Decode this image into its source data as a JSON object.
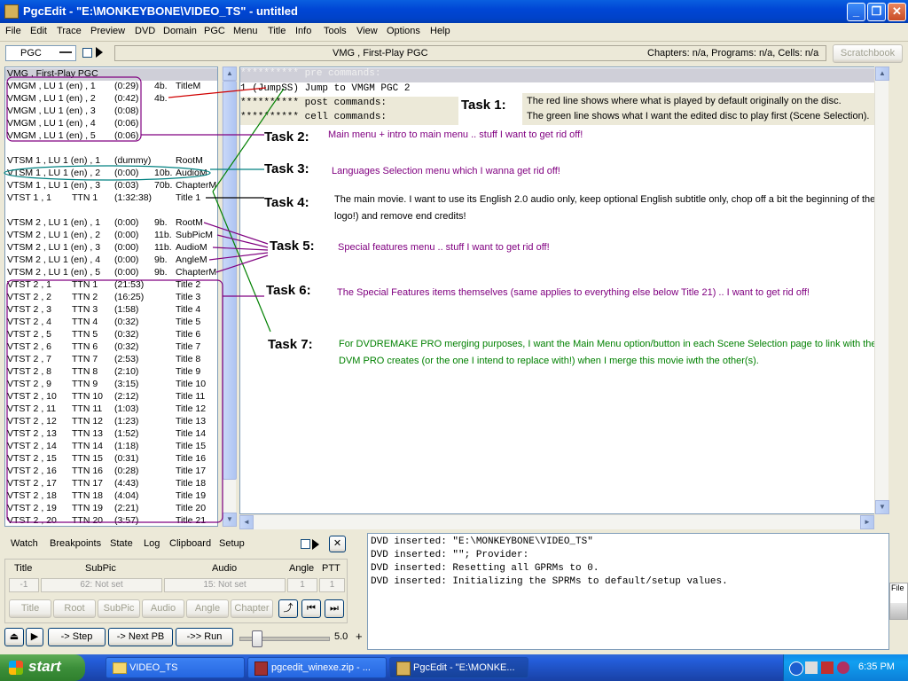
{
  "window": {
    "title": "PgcEdit - \"E:\\MONKEYBONE\\VIDEO_TS\" - untitled",
    "min_glyph": "_",
    "max_glyph": "❐",
    "close_glyph": "✕"
  },
  "menu": [
    "File",
    "Edit",
    "Trace",
    "Preview",
    "DVD",
    "Domain",
    "PGC",
    "Menu",
    "Title",
    "Info",
    "Tools",
    "View",
    "Options",
    "Help"
  ],
  "toolbar": {
    "domain_select": "PGC",
    "current_pgc": "VMG , First-Play PGC",
    "stats": "Chapters: n/a,  Programs: n/a,  Cells: n/a",
    "scratchbook": "Scratchbook"
  },
  "pgc_list": [
    {
      "name": "VMG , First-Play PGC",
      "ttn": "",
      "time": "",
      "size": "",
      "label": ""
    },
    {
      "name": "VMGM , LU 1 (en) , 1",
      "ttn": "",
      "time": "(0:29)",
      "size": "4b.",
      "label": "TitleM"
    },
    {
      "name": "VMGM , LU 1 (en) , 2",
      "ttn": "",
      "time": "(0:42)",
      "size": "4b.",
      "label": ""
    },
    {
      "name": "VMGM , LU 1 (en) , 3",
      "ttn": "",
      "time": "(0:08)",
      "size": "",
      "label": ""
    },
    {
      "name": "VMGM , LU 1 (en) , 4",
      "ttn": "",
      "time": "(0:06)",
      "size": "",
      "label": ""
    },
    {
      "name": "VMGM , LU 1 (en) , 5",
      "ttn": "",
      "time": "(0:06)",
      "size": "",
      "label": ""
    },
    {
      "name": "",
      "ttn": "",
      "time": "",
      "size": "",
      "label": ""
    },
    {
      "name": "VTSM 1 , LU 1 (en) , 1",
      "ttn": "",
      "time": "(dummy)",
      "size": "",
      "label": "RootM"
    },
    {
      "name": "VTSM 1 , LU 1 (en) , 2",
      "ttn": "",
      "time": "(0:00)",
      "size": "10b.",
      "label": "AudioM"
    },
    {
      "name": "VTSM 1 , LU 1 (en) , 3",
      "ttn": "",
      "time": "(0:03)",
      "size": "70b.",
      "label": "ChapterM"
    },
    {
      "name": "VTST 1 , 1",
      "ttn": "TTN 1",
      "time": "(1:32:38)",
      "size": "",
      "label": "Title 1"
    },
    {
      "name": "",
      "ttn": "",
      "time": "",
      "size": "",
      "label": ""
    },
    {
      "name": "VTSM 2 , LU 1 (en) , 1",
      "ttn": "",
      "time": "(0:00)",
      "size": "9b.",
      "label": "RootM"
    },
    {
      "name": "VTSM 2 , LU 1 (en) , 2",
      "ttn": "",
      "time": "(0:00)",
      "size": "11b.",
      "label": "SubPicM"
    },
    {
      "name": "VTSM 2 , LU 1 (en) , 3",
      "ttn": "",
      "time": "(0:00)",
      "size": "11b.",
      "label": "AudioM"
    },
    {
      "name": "VTSM 2 , LU 1 (en) , 4",
      "ttn": "",
      "time": "(0:00)",
      "size": "9b.",
      "label": "AngleM"
    },
    {
      "name": "VTSM 2 , LU 1 (en) , 5",
      "ttn": "",
      "time": "(0:00)",
      "size": "9b.",
      "label": "ChapterM"
    },
    {
      "name": "VTST 2 , 1",
      "ttn": "TTN 1",
      "time": "(21:53)",
      "size": "",
      "label": "Title 2"
    },
    {
      "name": "VTST 2 , 2",
      "ttn": "TTN 2",
      "time": "(16:25)",
      "size": "",
      "label": "Title 3"
    },
    {
      "name": "VTST 2 , 3",
      "ttn": "TTN 3",
      "time": "(1:58)",
      "size": "",
      "label": "Title 4"
    },
    {
      "name": "VTST 2 , 4",
      "ttn": "TTN 4",
      "time": "(0:32)",
      "size": "",
      "label": "Title 5"
    },
    {
      "name": "VTST 2 , 5",
      "ttn": "TTN 5",
      "time": "(0:32)",
      "size": "",
      "label": "Title 6"
    },
    {
      "name": "VTST 2 , 6",
      "ttn": "TTN 6",
      "time": "(0:32)",
      "size": "",
      "label": "Title 7"
    },
    {
      "name": "VTST 2 , 7",
      "ttn": "TTN 7",
      "time": "(2:53)",
      "size": "",
      "label": "Title 8"
    },
    {
      "name": "VTST 2 , 8",
      "ttn": "TTN 8",
      "time": "(2:10)",
      "size": "",
      "label": "Title 9"
    },
    {
      "name": "VTST 2 , 9",
      "ttn": "TTN 9",
      "time": "(3:15)",
      "size": "",
      "label": "Title 10"
    },
    {
      "name": "VTST 2 , 10",
      "ttn": "TTN 10",
      "time": "(2:12)",
      "size": "",
      "label": "Title 11"
    },
    {
      "name": "VTST 2 , 11",
      "ttn": "TTN 11",
      "time": "(1:03)",
      "size": "",
      "label": "Title 12"
    },
    {
      "name": "VTST 2 , 12",
      "ttn": "TTN 12",
      "time": "(1:23)",
      "size": "",
      "label": "Title 13"
    },
    {
      "name": "VTST 2 , 13",
      "ttn": "TTN 13",
      "time": "(1:52)",
      "size": "",
      "label": "Title 14"
    },
    {
      "name": "VTST 2 , 14",
      "ttn": "TTN 14",
      "time": "(1:18)",
      "size": "",
      "label": "Title 15"
    },
    {
      "name": "VTST 2 , 15",
      "ttn": "TTN 15",
      "time": "(0:31)",
      "size": "",
      "label": "Title 16"
    },
    {
      "name": "VTST 2 , 16",
      "ttn": "TTN 16",
      "time": "(0:28)",
      "size": "",
      "label": "Title 17"
    },
    {
      "name": "VTST 2 , 17",
      "ttn": "TTN 17",
      "time": "(4:43)",
      "size": "",
      "label": "Title 18"
    },
    {
      "name": "VTST 2 , 18",
      "ttn": "TTN 18",
      "time": "(4:04)",
      "size": "",
      "label": "Title 19"
    },
    {
      "name": "VTST 2 , 19",
      "ttn": "TTN 19",
      "time": "(2:21)",
      "size": "",
      "label": "Title 20"
    },
    {
      "name": "VTST 2 , 20",
      "ttn": "TTN 20",
      "time": "(3:57)",
      "size": "",
      "label": "Title 21"
    }
  ],
  "commands": {
    "pre": "********** pre commands:",
    "line1": " 1  (JumpSS) Jump to VMGM PGC 2",
    "post": "********** post commands:",
    "cell": "********** cell commands:"
  },
  "tasks": [
    {
      "label": "Task 1:",
      "text": [
        "The red line shows where what is played by default originally on the disc.",
        "The green line shows what I want the edited disc to play first (Scene Selection)."
      ]
    },
    {
      "label": "Task 2:",
      "text": [
        "Main menu + intro to main menu .. stuff I want to get rid off!"
      ]
    },
    {
      "label": "Task 3:",
      "text": [
        "Languages Selection menu which I wanna get rid off!"
      ]
    },
    {
      "label": "Task 4:",
      "text": [
        "The main movie. I want to use its English 2.0 audio only, keep optional English subtitle only, chop off a bit the beginning of the movie (studio",
        "logo!) and remove end credits!"
      ]
    },
    {
      "label": "Task 5:",
      "text": [
        "Special features menu .. stuff I want to get rid off!"
      ]
    },
    {
      "label": "Task 6:",
      "text": [
        "The Special Features items themselves (same applies to everything else below Title 21) .. I want to get rid off!"
      ]
    },
    {
      "label": "Task 7:",
      "text": [
        "For DVDREMAKE PRO merging purposes, I want the Main Menu option/button in each Scene Selection page to link with the DEFAULT menu that",
        "DVM PRO creates (or the one I intend to replace with!) when I merge this movie iwth the other(s)."
      ]
    }
  ],
  "colors": {
    "purple": "#800080",
    "green": "#008000",
    "red": "#d00000",
    "selection": "#cfcfd8"
  },
  "debug": {
    "tabs": [
      "Watch",
      "Breakpoints",
      "State",
      "Log",
      "Clipboard",
      "Setup"
    ],
    "close_glyph": "✕",
    "headers": [
      "Title",
      "SubPic",
      "Audio",
      "Angle",
      "PTT"
    ],
    "values": [
      "-1",
      "62: Not set",
      "15: Not set",
      "1",
      "1"
    ],
    "jump_buttons": [
      "Title",
      "Root",
      "SubPic",
      "Audio",
      "Angle",
      "Chapter"
    ],
    "step": "-> Step",
    "next_pb": "-> Next PB",
    "run": "->> Run",
    "speed": "5.0",
    "plus": "+"
  },
  "log": [
    "DVD inserted: \"E:\\MONKEYBONE\\VIDEO_TS\"",
    "DVD inserted: \"\"; Provider:",
    "DVD inserted: Resetting all GPRMs to 0.",
    "DVD inserted: Initializing the SPRMs to default/setup values."
  ],
  "side_label": "File",
  "taskbar": {
    "start": "start",
    "items": [
      "VIDEO_TS",
      "pgcedit_winexe.zip - ...",
      "PgcEdit - \"E:\\MONKE..."
    ],
    "clock": "6:35 PM"
  }
}
